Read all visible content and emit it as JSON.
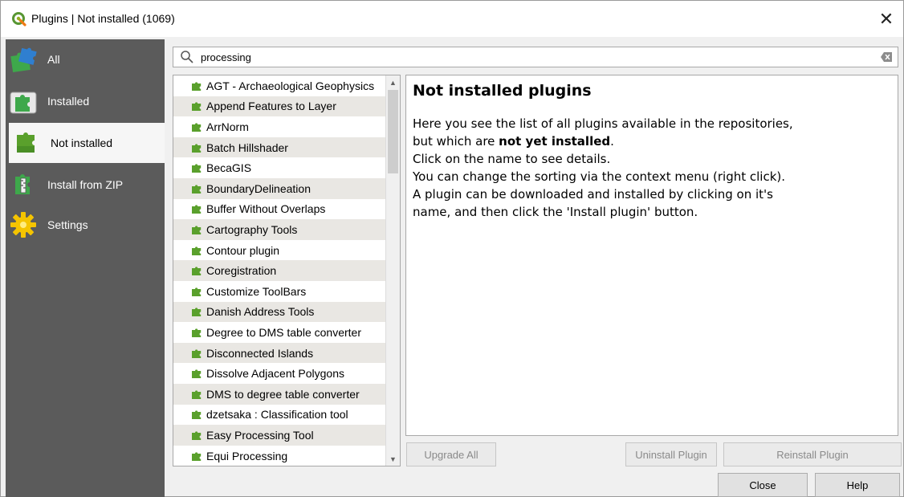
{
  "window": {
    "title": "Plugins | Not installed (1069)"
  },
  "sidebar": {
    "items": [
      {
        "label": "All",
        "icon": "puzzle-all-icon",
        "active": false
      },
      {
        "label": "Installed",
        "icon": "puzzle-installed-icon",
        "active": false
      },
      {
        "label": "Not installed",
        "icon": "puzzle-not-installed-icon",
        "active": true
      },
      {
        "label": "Install from ZIP",
        "icon": "puzzle-zip-icon",
        "active": false
      },
      {
        "label": "Settings",
        "icon": "gear-icon",
        "active": false
      }
    ]
  },
  "search": {
    "value": "processing"
  },
  "plugins": [
    "AGT - Archaeological Geophysics",
    "Append Features to Layer",
    "ArrNorm",
    "Batch Hillshader",
    "BecaGIS",
    "BoundaryDelineation",
    "Buffer Without Overlaps",
    "Cartography Tools",
    "Contour plugin",
    "Coregistration",
    "Customize ToolBars",
    "Danish Address Tools",
    "Degree to DMS table converter",
    "Disconnected Islands",
    "Dissolve Adjacent Polygons",
    "DMS to degree table converter",
    "dzetsaka : Classification tool",
    "Easy Processing Tool",
    "Equi Processing"
  ],
  "details": {
    "heading": "Not installed plugins",
    "line1": "Here you see the list of all plugins available in the repositories,",
    "line2_pre": "but which are ",
    "line2_bold": "not yet installed",
    "line2_post": ".",
    "line3": "Click on the name to see details.",
    "line4": "You can change the sorting via the context menu (right click).",
    "line5": "A plugin can be downloaded and installed by clicking on it's",
    "line6": "name, and then click the 'Install plugin' button."
  },
  "buttons": {
    "upgrade_all": "Upgrade All",
    "uninstall": "Uninstall Plugin",
    "reinstall": "Reinstall Plugin",
    "close": "Close",
    "help": "Help"
  },
  "colors": {
    "sidebar_bg": "#5b5b5b",
    "plugin_icon": "#5aa02c",
    "row_alt": "#e9e7e3"
  }
}
